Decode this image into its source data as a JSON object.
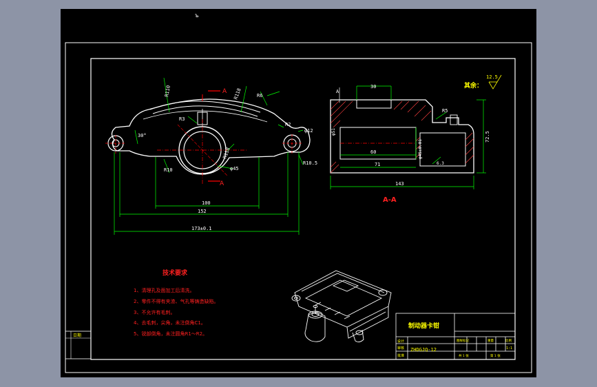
{
  "window": {
    "cursor_mark": "ъ"
  },
  "drawing": {
    "title": "制动器卡钳",
    "drawing_number": "ZHDGJQ-12",
    "section_label": "A-A",
    "section_marker": "A",
    "remaining_surfaces": "其余：",
    "roughness_value": "12.5"
  },
  "dimensions": {
    "main_view": {
      "d100": "100",
      "d152": "152",
      "d173": "173±0.1",
      "r10": "R10",
      "r6": "R6",
      "r3": "R3",
      "r2": "R2",
      "r10b": "R10",
      "r11": "R110",
      "r118": "R118",
      "phi12": "φ12",
      "phi45": "φ45",
      "r10_5": "R10.5",
      "ang30": "30°"
    },
    "section_view": {
      "d30": "30",
      "d60": "60",
      "d71": "71",
      "d143": "143",
      "d72_5": "72.5",
      "r5": "R5",
      "phi51": "φ51",
      "phi45": "φ45.7",
      "tol": "φ45±0.01",
      "r5b": "6.3"
    }
  },
  "technical_requirements": {
    "heading": "技术要求",
    "items": [
      "1、清理孔及面加工后清洗。",
      "2、零件不得有夹渣、气孔等铸造缺陷。",
      "3、不允许有毛刺。",
      "4、去毛刺，尖角，未注倒角C1。",
      "5、锐部倒角，未注圆角R1～R2。"
    ]
  },
  "title_block": {
    "row_labels": [
      "设计",
      "审核",
      "批准"
    ],
    "header_labels": [
      "图样标记",
      "重量",
      "比例"
    ],
    "scale": "1:1",
    "sheet": "共 1 张",
    "sheet_of": "第 1 张",
    "left_label": "日期"
  },
  "colors": {
    "background": "#000000",
    "outline": "#ffffff",
    "dimension": "#00ff00",
    "centerline": "#ff0000",
    "text_red": "#ff2020",
    "yellow": "#ffff00",
    "hatch": "#ff4040"
  }
}
